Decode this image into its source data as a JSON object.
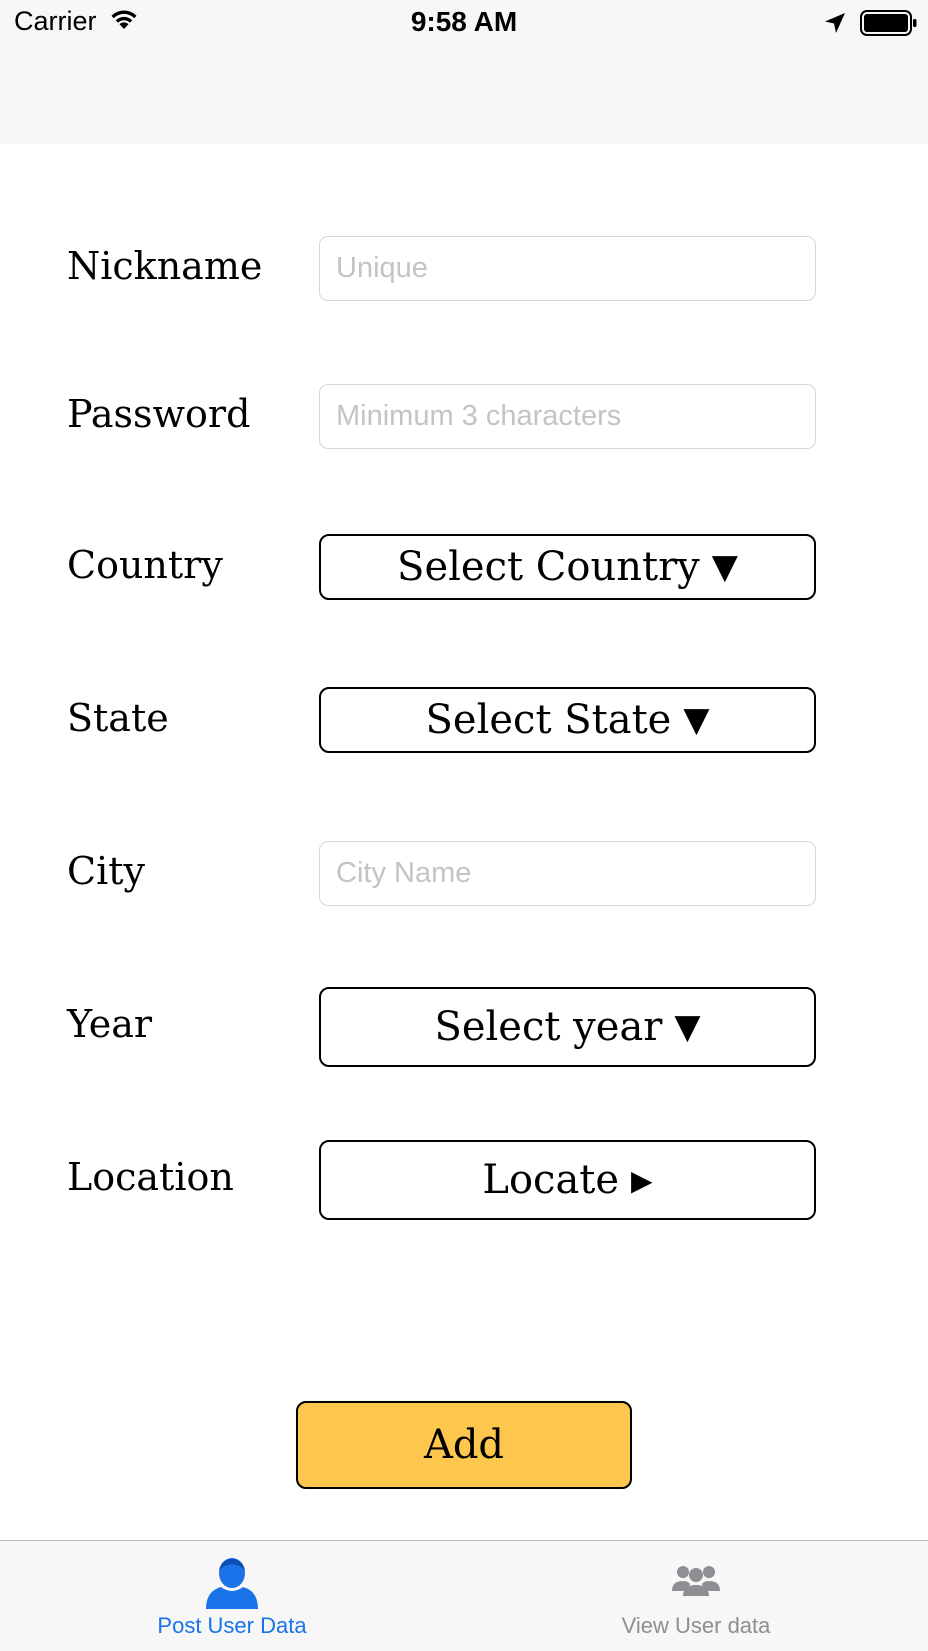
{
  "status_bar": {
    "carrier": "Carrier",
    "time": "9:58 AM",
    "icons": [
      "wifi-icon",
      "location-arrow-icon",
      "battery-icon"
    ]
  },
  "form": {
    "nickname": {
      "label": "Nickname",
      "placeholder": "Unique",
      "value": ""
    },
    "password": {
      "label": "Password",
      "placeholder": "Minimum 3 characters",
      "value": ""
    },
    "country": {
      "label": "Country",
      "button": "Select Country",
      "caret": "▼"
    },
    "state": {
      "label": "State",
      "button": "Select State",
      "caret": "▼"
    },
    "city": {
      "label": "City",
      "placeholder": "City Name",
      "value": ""
    },
    "year": {
      "label": "Year",
      "button": "Select year",
      "caret": "▼"
    },
    "location": {
      "label": "Location",
      "button": "Locate",
      "caret": "▶"
    }
  },
  "add_button": {
    "label": "Add",
    "color": "#fdc64c"
  },
  "tab_bar": {
    "tabs": [
      {
        "label": "Post User Data",
        "icon": "user-icon",
        "selected": true,
        "color": "#1a73e8"
      },
      {
        "label": "View User data",
        "icon": "users-group-icon",
        "selected": false,
        "color": "#8e8e93"
      }
    ]
  },
  "colors": {
    "accent": "#1a73e8",
    "inactive": "#8e8e93",
    "bar_background": "#f7f7f7"
  }
}
